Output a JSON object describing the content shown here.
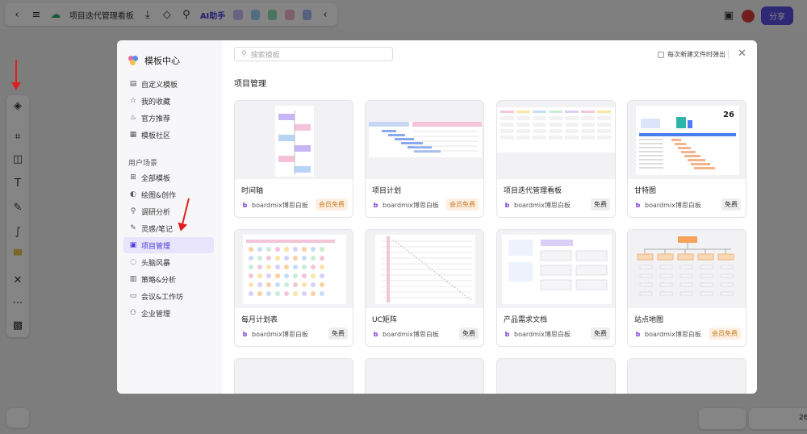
{
  "app": {
    "doc_title": "项目迭代管理看板",
    "ai_label": "AI助手",
    "share_label": "分享",
    "zoom_partial": "26"
  },
  "modal": {
    "title": "模板中心",
    "search_placeholder": "搜索模板",
    "checkbox_label": "每次新建文件时弹出",
    "category_heading": "项目管理",
    "section_heading": "用户场景",
    "nav_top": [
      {
        "label": "自定义模板",
        "icon": "custom-template-icon",
        "glyph": "▤"
      },
      {
        "label": "我的收藏",
        "icon": "star-icon",
        "glyph": "☆"
      },
      {
        "label": "官方推荐",
        "icon": "thumbs-up-icon",
        "glyph": "♨"
      },
      {
        "label": "模板社区",
        "icon": "community-icon",
        "glyph": "▦"
      }
    ],
    "nav_scenes": [
      {
        "label": "全部模板",
        "icon": "grid-icon",
        "glyph": "⊞"
      },
      {
        "label": "绘图&创作",
        "icon": "palette-icon",
        "glyph": "◐"
      },
      {
        "label": "调研分析",
        "icon": "research-icon",
        "glyph": "⚲"
      },
      {
        "label": "灵感/笔记",
        "icon": "rocket-icon",
        "glyph": "✎"
      },
      {
        "label": "项目管理",
        "icon": "project-icon",
        "glyph": "▣"
      },
      {
        "label": "头脑风暴",
        "icon": "bulb-icon",
        "glyph": "◌"
      },
      {
        "label": "策略&分析",
        "icon": "strategy-icon",
        "glyph": "▥"
      },
      {
        "label": "会议&工作坊",
        "icon": "meeting-icon",
        "glyph": "▭"
      },
      {
        "label": "企业管理",
        "icon": "org-icon",
        "glyph": "⚇"
      }
    ],
    "active_nav": "项目管理",
    "cards": [
      {
        "name": "时间轴",
        "author": "boardmix博思白板",
        "badge": "会员免费",
        "badge_type": "mem"
      },
      {
        "name": "项目计划",
        "author": "boardmix博思白板",
        "badge": "会员免费",
        "badge_type": "mem"
      },
      {
        "name": "项目迭代管理看板",
        "author": "boardmix博思白板",
        "badge": "免费",
        "badge_type": "free"
      },
      {
        "name": "甘特图",
        "author": "boardmix博思白板",
        "badge": "免费",
        "badge_type": "free"
      },
      {
        "name": "每月计划表",
        "author": "boardmix博思白板",
        "badge": "免费",
        "badge_type": "free"
      },
      {
        "name": "UC矩阵",
        "author": "boardmix博思白板",
        "badge": "免费",
        "badge_type": "free"
      },
      {
        "name": "产品需求文档",
        "author": "boardmix博思白板",
        "badge": "免费",
        "badge_type": "free"
      },
      {
        "name": "站点地图",
        "author": "boardmix博思白板",
        "badge": "会员免费",
        "badge_type": "mem"
      }
    ],
    "gantt_day": "26"
  },
  "colors": {
    "accent": "#5b4de0",
    "arrow": "#e02020"
  }
}
